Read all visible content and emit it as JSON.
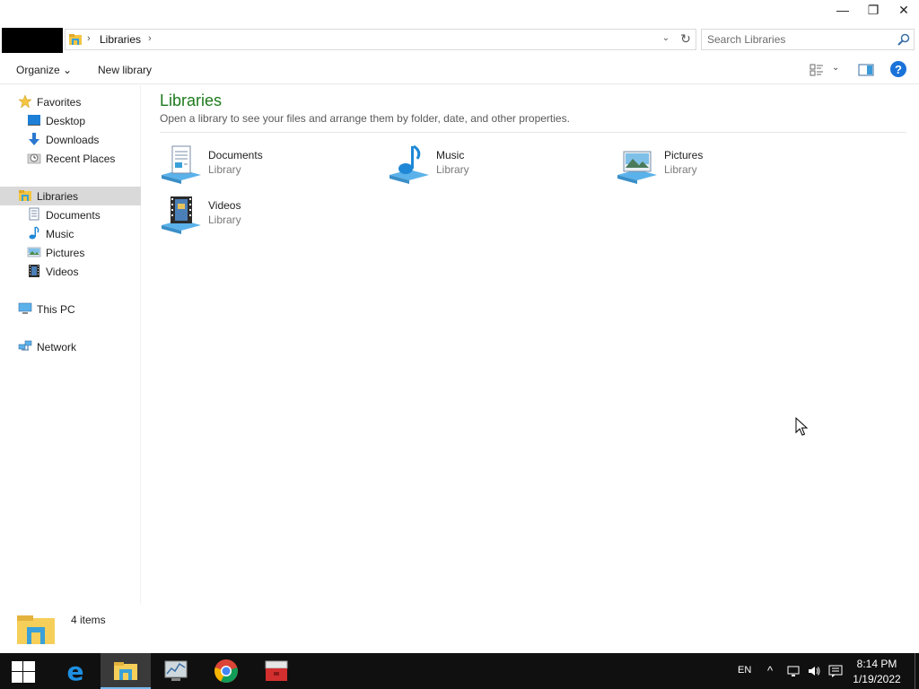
{
  "window": {
    "min_glyph": "—",
    "max_glyph": "❐",
    "close_glyph": "✕"
  },
  "address": {
    "path": "Libraries",
    "dropdown_glyph": "⌄",
    "refresh_glyph": "↻"
  },
  "search": {
    "placeholder": "Search Libraries"
  },
  "toolbar": {
    "organize_label": "Organize ⌄",
    "new_library_label": "New library",
    "view_dropdown_glyph": "⌄",
    "help_glyph": "?"
  },
  "nav": {
    "favorites": "Favorites",
    "desktop": "Desktop",
    "downloads": "Downloads",
    "recent_places": "Recent Places",
    "libraries": "Libraries",
    "documents": "Documents",
    "music": "Music",
    "pictures": "Pictures",
    "videos": "Videos",
    "this_pc": "This PC",
    "network": "Network"
  },
  "content": {
    "heading": "Libraries",
    "subheading": "Open a library to see your files and arrange them by folder, date, and other properties.",
    "libraries": [
      {
        "name": "Documents",
        "type": "Library",
        "icon": "documents-library-icon"
      },
      {
        "name": "Music",
        "type": "Library",
        "icon": "music-library-icon"
      },
      {
        "name": "Pictures",
        "type": "Library",
        "icon": "pictures-library-icon"
      },
      {
        "name": "Videos",
        "type": "Library",
        "icon": "videos-library-icon"
      }
    ]
  },
  "details": {
    "item_count": "4 items"
  },
  "taskbar": {
    "apps": [
      "start-icon",
      "edge-icon",
      "file-explorer-icon",
      "performance-monitor-icon",
      "chrome-icon",
      "toolbox-icon"
    ],
    "language": "EN",
    "time": "8:14 PM",
    "date": "1/19/2022"
  },
  "colors": {
    "heading_green": "#1e7a1e",
    "selection_gray": "#d9d9d9",
    "taskbar_bg": "#101010",
    "accent_blue": "#1a73d9"
  }
}
